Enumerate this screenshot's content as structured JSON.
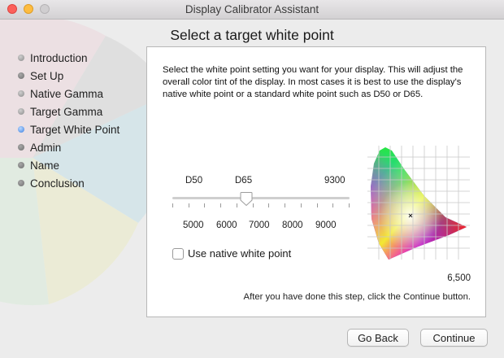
{
  "window": {
    "title": "Display Calibrator Assistant"
  },
  "page_title": "Select a target white point",
  "steps": [
    {
      "label": "Introduction",
      "state": "done"
    },
    {
      "label": "Set Up",
      "state": "pending"
    },
    {
      "label": "Native Gamma",
      "state": "done"
    },
    {
      "label": "Target Gamma",
      "state": "done"
    },
    {
      "label": "Target White Point",
      "state": "current"
    },
    {
      "label": "Admin",
      "state": "pending"
    },
    {
      "label": "Name",
      "state": "pending"
    },
    {
      "label": "Conclusion",
      "state": "pending"
    }
  ],
  "panel": {
    "description": "Select the white point setting you want for your display.  This will adjust the overall color tint of the display.  In most cases it is best to use the display's native white point or a standard white point such as D50 or D65.",
    "slider": {
      "top_labels": [
        "D50",
        "D65",
        "9300"
      ],
      "scale_labels": [
        "5000",
        "6000",
        "7000",
        "8000",
        "9000"
      ],
      "min_kelvin": 4500,
      "max_kelvin": 9300,
      "value_kelvin": 6500
    },
    "native_checkbox": {
      "label": "Use native white point",
      "checked": false
    },
    "white_point_value": "6,500",
    "hint": "After you have done this step, click the Continue button."
  },
  "buttons": {
    "back": "Go Back",
    "continue": "Continue"
  },
  "colors": {
    "current_step": "#3b7fe0",
    "close": "#fc605b",
    "minimize": "#fdbc40"
  },
  "icons": {
    "slider_thumb": "slider-thumb-icon",
    "gamut_diagram": "chromaticity-diagram-icon"
  }
}
